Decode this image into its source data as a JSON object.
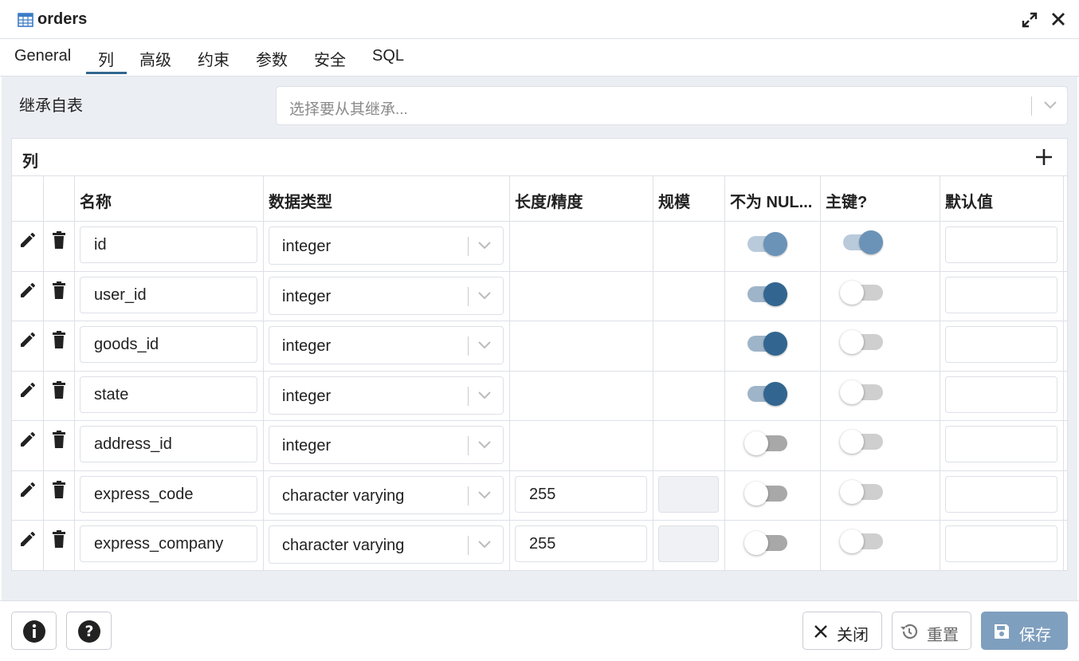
{
  "window": {
    "title": "orders",
    "table_icon": "table-icon",
    "expand_icon": "expand-icon",
    "close_icon": "close-icon"
  },
  "tabs": [
    {
      "label": "General"
    },
    {
      "label": "列",
      "active": true
    },
    {
      "label": "高级"
    },
    {
      "label": "约束"
    },
    {
      "label": "参数"
    },
    {
      "label": "安全"
    },
    {
      "label": "SQL"
    }
  ],
  "inherit": {
    "label": "继承自表",
    "placeholder": "选择要从其继承..."
  },
  "columns_panel": {
    "title": "列",
    "headers": {
      "name": "名称",
      "type": "数据类型",
      "length": "长度/精度",
      "scale": "规模",
      "not_null": "不为 NUL...",
      "primary_key": "主键?",
      "default": "默认值"
    },
    "rows": [
      {
        "name": "id",
        "type": "integer",
        "length": "",
        "not_null": true,
        "pk": true
      },
      {
        "name": "user_id",
        "type": "integer",
        "length": "",
        "not_null": true,
        "pk": false
      },
      {
        "name": "goods_id",
        "type": "integer",
        "length": "",
        "not_null": true,
        "pk": false
      },
      {
        "name": "state",
        "type": "integer",
        "length": "",
        "not_null": true,
        "pk": false
      },
      {
        "name": "address_id",
        "type": "integer",
        "length": "",
        "not_null": false,
        "pk": false
      },
      {
        "name": "express_code",
        "type": "character varying",
        "length": "255",
        "not_null": false,
        "pk": false
      },
      {
        "name": "express_company",
        "type": "character varying",
        "length": "255",
        "not_null": false,
        "pk": false
      }
    ]
  },
  "footer": {
    "info_icon": "info-icon",
    "help_icon": "help-icon",
    "close_label": "关闭",
    "reset_label": "重置",
    "save_label": "保存"
  },
  "colors": {
    "accent": "#326690",
    "save_button": "#7f9fbe",
    "background": "#ebeef3"
  }
}
